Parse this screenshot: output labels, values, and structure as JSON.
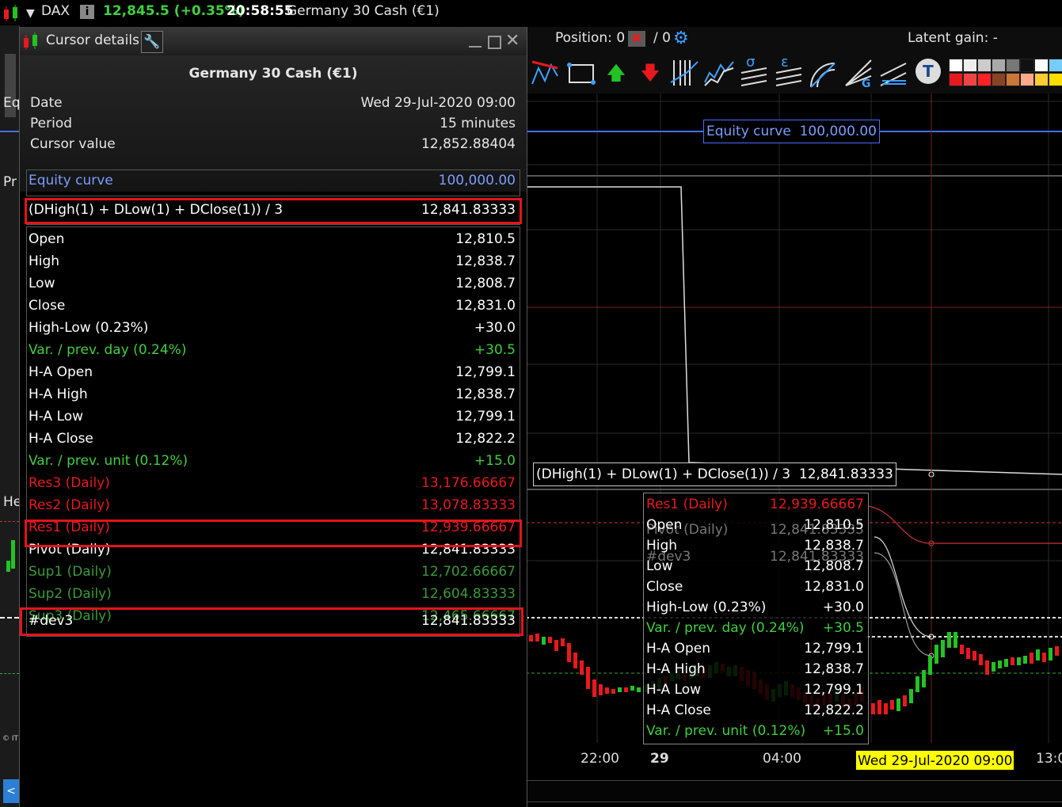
{
  "topbar": {
    "symbol": "DAX",
    "price": "12,845.5 (+0.35%)",
    "time": "20:58:55",
    "instrument": "Germany 30 Cash (€1)"
  },
  "leftstrip": {
    "labels": [
      "Eq",
      "Pr",
      "He",
      "© IT"
    ]
  },
  "panel": {
    "title": "Cursor details",
    "instrument": "Germany 30 Cash (€1)",
    "header_rows": [
      {
        "k": "Date",
        "v": "Wed 29-Jul-2020 09:00"
      },
      {
        "k": "Period",
        "v": "15 minutes"
      },
      {
        "k": "Cursor value",
        "v": "12,852.88404"
      }
    ],
    "equity": {
      "k": "Equity curve",
      "v": "100,000.00"
    },
    "pivot_formula": {
      "k": "(DHigh(1) + DLow(1) + DClose(1)) / 3",
      "v": "12,841.83333"
    },
    "ohlc_rows": [
      {
        "k": "Open",
        "v": "12,810.5",
        "c": "white"
      },
      {
        "k": "High",
        "v": "12,838.7",
        "c": "white"
      },
      {
        "k": "Low",
        "v": "12,808.7",
        "c": "white"
      },
      {
        "k": "Close",
        "v": "12,831.0",
        "c": "white"
      },
      {
        "k": "High-Low (0.23%)",
        "v": "+30.0",
        "c": "white"
      },
      {
        "k": "Var. / prev. day (0.24%)",
        "v": "+30.5",
        "c": "green"
      },
      {
        "k": "H-A Open",
        "v": "12,799.1",
        "c": "white"
      },
      {
        "k": "H-A High",
        "v": "12,838.7",
        "c": "white"
      },
      {
        "k": "H-A Low",
        "v": "12,799.1",
        "c": "white"
      },
      {
        "k": "H-A Close",
        "v": "12,822.2",
        "c": "white"
      },
      {
        "k": "Var. / prev. unit (0.12%)",
        "v": "+15.0",
        "c": "green"
      },
      {
        "k": "Res3 (Daily)",
        "v": "13,176.66667",
        "c": "red"
      },
      {
        "k": "Res2 (Daily)",
        "v": "13,078.83333",
        "c": "red"
      },
      {
        "k": "Res1 (Daily)",
        "v": "12,939.66667",
        "c": "red"
      },
      {
        "k": "Pivot (Daily)",
        "v": "12,841.83333",
        "c": "white"
      },
      {
        "k": "Sup1 (Daily)",
        "v": "12,702.66667",
        "c": "dkgreen"
      },
      {
        "k": "Sup2 (Daily)",
        "v": "12,604.83333",
        "c": "dkgreen"
      },
      {
        "k": "Sup3 (Daily)",
        "v": "12,465.66667",
        "c": "dkgreen"
      }
    ],
    "dev": {
      "k": "#dev3",
      "v": "12,841.83333"
    }
  },
  "chart": {
    "position_label": "Position: 0",
    "position_sep": "/ 0",
    "latent_gain": "Latent gain: -",
    "equity_tag": {
      "k": "Equity curve",
      "v": "100,000.00"
    },
    "pivot_tag": {
      "k": "(DHigh(1) + DLow(1) + DClose(1)) / 3",
      "v": "12,841.83333"
    },
    "tooltip_behind": [
      {
        "k": "Pivot (Daily)",
        "v": "12,841.83333"
      },
      {
        "k": "#dev3",
        "v": "12,841.83333"
      }
    ],
    "tooltip_rows": [
      {
        "k": "Res1 (Daily)",
        "v": "12,939.66667",
        "c": "red"
      },
      {
        "k": "Open",
        "v": "12,810.5",
        "c": "white"
      },
      {
        "k": "High",
        "v": "12,838.7",
        "c": "white"
      },
      {
        "k": "Low",
        "v": "12,808.7",
        "c": "white"
      },
      {
        "k": "Close",
        "v": "12,831.0",
        "c": "white"
      },
      {
        "k": "High-Low (0.23%)",
        "v": "+30.0",
        "c": "white"
      },
      {
        "k": "Var. / prev. day (0.24%)",
        "v": "+30.5",
        "c": "green"
      },
      {
        "k": "H-A Open",
        "v": "12,799.1",
        "c": "white"
      },
      {
        "k": "H-A High",
        "v": "12,838.7",
        "c": "white"
      },
      {
        "k": "H-A Low",
        "v": "12,799.1",
        "c": "white"
      },
      {
        "k": "H-A Close",
        "v": "12,822.2",
        "c": "white"
      },
      {
        "k": "Var. / prev. unit (0.12%)",
        "v": "+15.0",
        "c": "green"
      }
    ],
    "x_labels": [
      "22:00",
      "29",
      "04:00",
      "13:0"
    ],
    "cursor_date": "Wed 29-Jul-2020 09:00"
  },
  "colors": {
    "accent_blue": "#4a6cf7",
    "highlight_red": "#e3141b",
    "bull_green": "#22c322",
    "bear_red": "#e8191e",
    "cursor_date_bg": "#ffff00"
  },
  "icons": [
    "candlestick-icon",
    "chevron-down-icon",
    "info-icon",
    "wrench-icon",
    "minimize-icon",
    "maximize-icon",
    "close-icon",
    "cancel-position-icon",
    "settings-gear-icon",
    "trendline-icon",
    "rectangle-icon",
    "buy-arrow-icon",
    "sell-arrow-icon",
    "fibonacci-icon",
    "wave-icon",
    "sigma-icon",
    "epsilon-icon",
    "arc-icon",
    "fan-icon",
    "channel-icon",
    "text-icon",
    "color-palette"
  ]
}
